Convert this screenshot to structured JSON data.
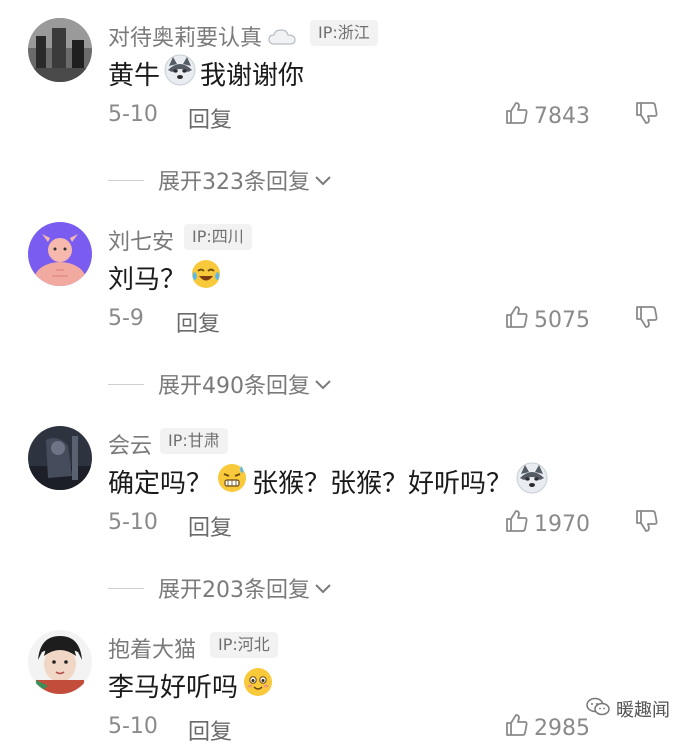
{
  "comments": [
    {
      "username": "对待奥莉要认真",
      "ip": "IP:浙江",
      "content_a": "黄牛",
      "content_b": "我谢谢你",
      "date": "5-10",
      "reply": "回复",
      "likes": "7843",
      "expand": "展开323条回复"
    },
    {
      "username": "刘七安",
      "ip": "IP:四川",
      "content_a": "刘马？",
      "content_b": "",
      "date": "5-9",
      "reply": "回复",
      "likes": "5075",
      "expand": "展开490条回复"
    },
    {
      "username": "会云",
      "ip": "IP:甘肃",
      "content_a": "确定吗？",
      "content_b": "张猴？张猴？好听吗？",
      "date": "5-10",
      "reply": "回复",
      "likes": "1970",
      "expand": "展开203条回复"
    },
    {
      "username": "抱着大猫",
      "ip": "IP:河北",
      "content_a": "李马好听吗",
      "content_b": "",
      "date": "5-10",
      "reply": "回复",
      "likes": "2985",
      "expand": ""
    }
  ],
  "watermark": "暖趣闻",
  "icons": {
    "like": "thumbs-up-icon",
    "dislike": "thumbs-down-icon",
    "expand": "chevron-down-icon"
  }
}
